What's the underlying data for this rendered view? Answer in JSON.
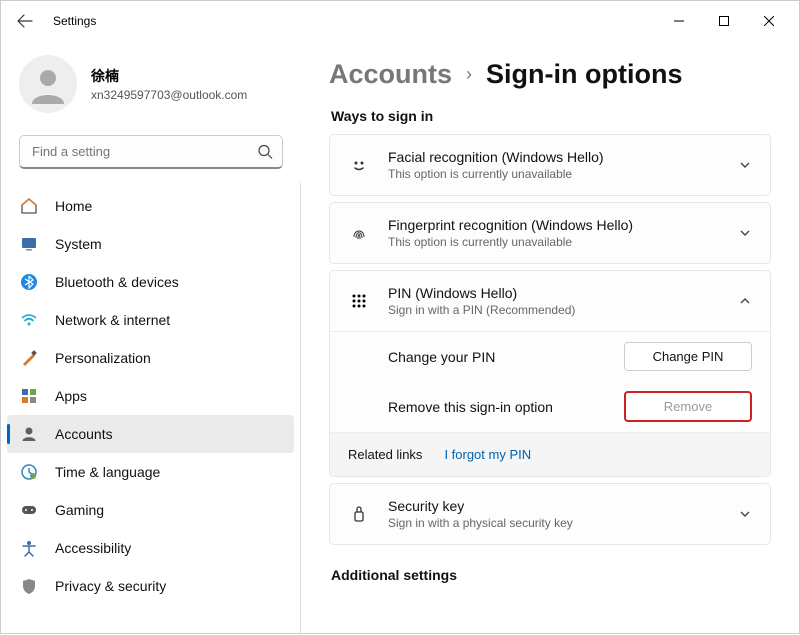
{
  "titlebar": {
    "title": "Settings"
  },
  "profile": {
    "name": "徐楠",
    "email": "xn3249597703@outlook.com"
  },
  "search": {
    "placeholder": "Find a setting"
  },
  "sidebar": {
    "items": [
      {
        "label": "Home"
      },
      {
        "label": "System"
      },
      {
        "label": "Bluetooth & devices"
      },
      {
        "label": "Network & internet"
      },
      {
        "label": "Personalization"
      },
      {
        "label": "Apps"
      },
      {
        "label": "Accounts"
      },
      {
        "label": "Time & language"
      },
      {
        "label": "Gaming"
      },
      {
        "label": "Accessibility"
      },
      {
        "label": "Privacy & security"
      }
    ]
  },
  "breadcrumb": {
    "parent": "Accounts",
    "current": "Sign-in options"
  },
  "sections": {
    "ways": "Ways to sign in",
    "additional": "Additional settings"
  },
  "signin": {
    "face": {
      "title": "Facial recognition (Windows Hello)",
      "sub": "This option is currently unavailable"
    },
    "finger": {
      "title": "Fingerprint recognition (Windows Hello)",
      "sub": "This option is currently unavailable"
    },
    "pin": {
      "title": "PIN (Windows Hello)",
      "sub": "Sign in with a PIN (Recommended)",
      "change_label": "Change your PIN",
      "change_btn": "Change PIN",
      "remove_label": "Remove this sign-in option",
      "remove_btn": "Remove",
      "related": "Related links",
      "forgot": "I forgot my PIN"
    },
    "key": {
      "title": "Security key",
      "sub": "Sign in with a physical security key"
    }
  }
}
